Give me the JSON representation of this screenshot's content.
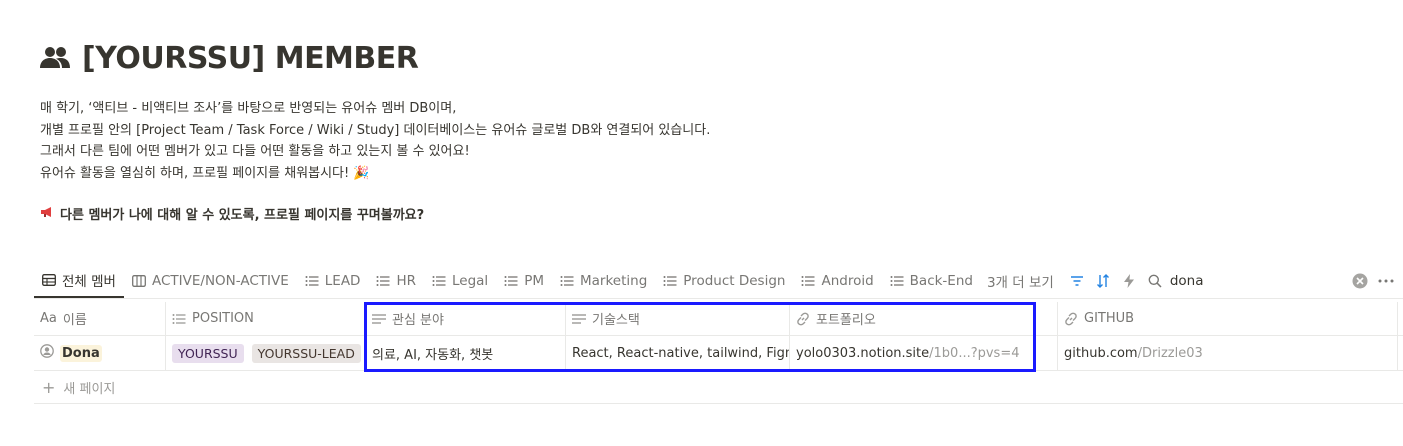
{
  "page": {
    "title": "[YOURSSU] MEMBER",
    "description": [
      "매 학기, ‘액티브 - 비액티브 조사’를 바탕으로 반영되는 유어슈 멤버 DB이며,",
      "개별 프로필 안의 [Project Team / Task Force / Wiki / Study] 데이터베이스는 유어슈 글로벌 DB와 연결되어 있습니다.",
      "그래서 다른 팀에 어떤 멤버가 있고 다들 어떤 활동을 하고 있는지 볼 수 있어요!",
      "유어슈 활동을 열심히 하며, 프로필 페이지를 채워봅시다! 🎉"
    ],
    "callout": "다른 멤버가 나에 대해 알 수 있도록, 프로필 페이지를 꾸며볼까요?"
  },
  "views": [
    {
      "label": "전체 멤버",
      "icon": "table-icon"
    },
    {
      "label": "ACTIVE/NON-ACTIVE",
      "icon": "board-icon"
    },
    {
      "label": "LEAD",
      "icon": "list-icon"
    },
    {
      "label": "HR",
      "icon": "list-icon"
    },
    {
      "label": "Legal",
      "icon": "list-icon"
    },
    {
      "label": "PM",
      "icon": "list-icon"
    },
    {
      "label": "Marketing",
      "icon": "list-icon"
    },
    {
      "label": "Product Design",
      "icon": "list-icon"
    },
    {
      "label": "Android",
      "icon": "list-icon"
    },
    {
      "label": "Back-End",
      "icon": "list-icon"
    }
  ],
  "more_views": "3개 더 보기",
  "search": {
    "value": "dona"
  },
  "colors": {
    "accent": "#2383e2",
    "highlight_box": "#1a1aff"
  },
  "table": {
    "columns": [
      {
        "label": "이름",
        "icon": "Aa"
      },
      {
        "label": "POSITION",
        "icon": "list-icon"
      },
      {
        "label": "관심 분야",
        "icon": "text-icon"
      },
      {
        "label": "기술스택",
        "icon": "text-icon"
      },
      {
        "label": "포트폴리오",
        "icon": "link-icon"
      },
      {
        "label": "GITHUB",
        "icon": "link-icon"
      }
    ],
    "rows": [
      {
        "name": "Dona",
        "positions": [
          "YOURSSU",
          "YOURSSU-LEAD"
        ],
        "interest": "의료, AI, 자동화, 챗봇",
        "stack": "React, React-native, tailwind, Figma",
        "portfolio_main": "yolo0303.notion.site",
        "portfolio_rest": "/1b0...?pvs=4",
        "github_main": "github.com",
        "github_rest": "/Drizzle03"
      }
    ],
    "new_page": "새 페이지"
  }
}
